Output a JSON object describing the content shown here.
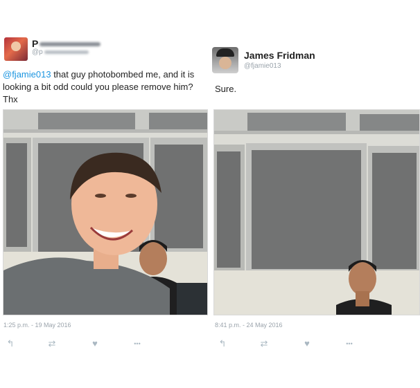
{
  "tweets": [
    {
      "name": "P",
      "handle": "@p",
      "mention": "@fjamie013",
      "text": " that guy photobombed me, and it is looking a bit odd could you please remove him? Thx",
      "timestamp": "1:25 p.m. - 19 May 2016"
    },
    {
      "name": "James Fridman",
      "handle": "@fjamie013",
      "text": "Sure.",
      "timestamp": "8:41 p.m. - 24 May 2016"
    }
  ],
  "actions": {
    "reply_icon": "↰",
    "retweet_icon": "⇄",
    "like_icon": "♥",
    "more_icon": "•••"
  },
  "colors": {
    "mention": "#1b95e0",
    "meta_text": "#9aa3ab",
    "action_icons": "#aab8c2"
  }
}
